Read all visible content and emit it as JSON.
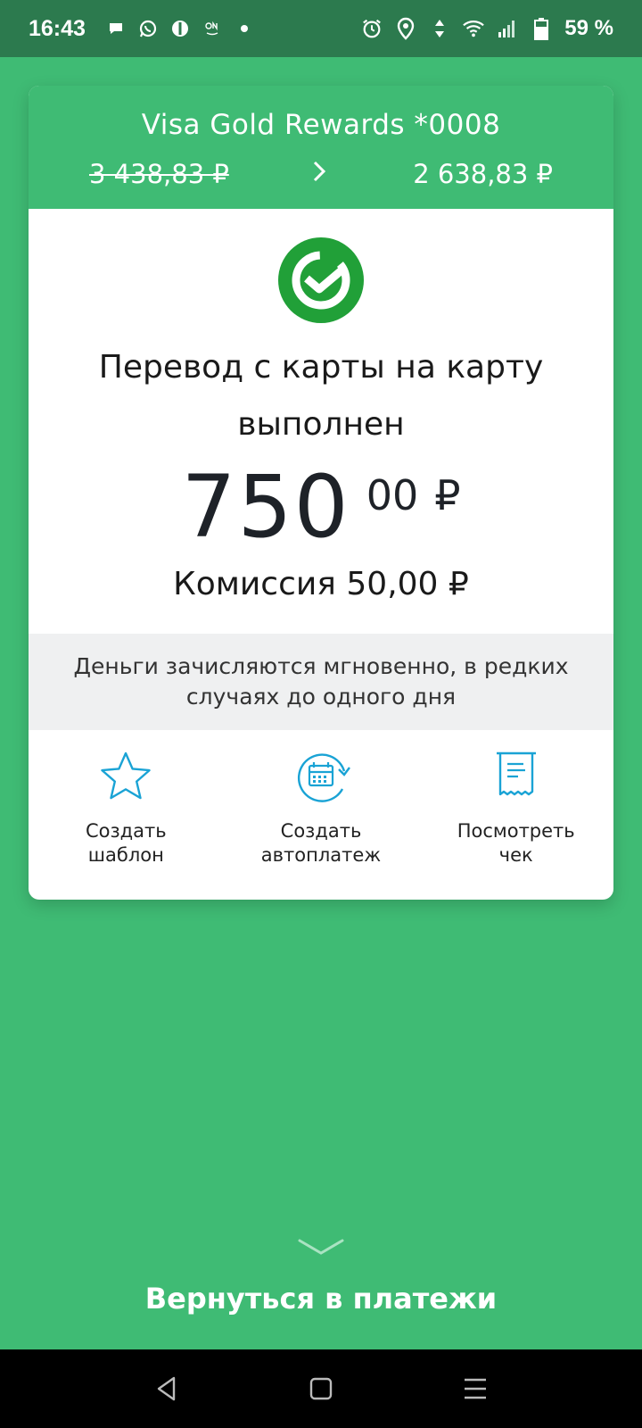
{
  "status_bar": {
    "time": "16:43",
    "left_icons": [
      "chat-bubble-icon",
      "whatsapp-icon",
      "app-icon",
      "on-icon",
      "dot-icon"
    ],
    "right_icons": [
      "alarm-icon",
      "location-icon",
      "data-arrows-icon",
      "wifi-icon",
      "signal-icon",
      "battery-icon"
    ],
    "battery_text": "59 %"
  },
  "card": {
    "name": "Visa Gold Rewards *0008",
    "balance_old": "3 438,83 ₽",
    "balance_new": "2 638,83 ₽",
    "status_title": "Перевод с карты на карту выполнен",
    "amount_int": "750",
    "amount_frac": "00",
    "currency": "₽",
    "commission": "Комиссия 50,00 ₽",
    "notice": "Деньги зачисляются мгновенно, в редких случаях до одного дня"
  },
  "actions": [
    {
      "label": "Создать\nшаблон",
      "icon": "star-icon"
    },
    {
      "label": "Создать\nавтоплатеж",
      "icon": "calendar-repeat-icon"
    },
    {
      "label": "Посмотреть\nчек",
      "icon": "receipt-icon"
    }
  ],
  "back_label": "Вернуться в платежи",
  "colors": {
    "brand_green": "#3fbb74",
    "status_bar": "#2c7a4e",
    "icon_blue": "#1aa3d5",
    "success_green": "#21a038"
  },
  "nav": {
    "icons": [
      "back-triangle-icon",
      "home-square-icon",
      "menu-lines-icon"
    ]
  }
}
